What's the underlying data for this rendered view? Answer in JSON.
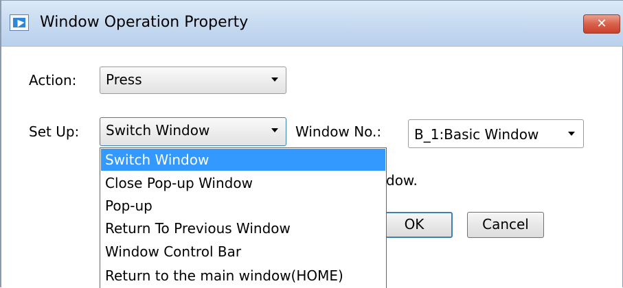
{
  "window": {
    "title": "Window Operation Property",
    "close_label": "✕"
  },
  "action": {
    "label": "Action:",
    "value": "Press"
  },
  "setup": {
    "label": "Set Up:",
    "value": "Switch Window"
  },
  "window_no": {
    "label": "Window No.:",
    "value": "B_1:Basic Window"
  },
  "hidden_text_fragment": "dow.",
  "dropdown": {
    "items": [
      "Switch Window",
      "Close Pop-up Window",
      "Pop-up",
      "Return To Previous Window",
      "Window Control Bar",
      "Return to the main window(HOME)"
    ],
    "selected": "Switch Window"
  },
  "buttons": {
    "ok": "OK",
    "cancel": "Cancel"
  },
  "colors": {
    "selection": "#3399ff",
    "titlebar": "#c9dcf1",
    "close_button": "#d9614c",
    "focus_border": "#3c7fb1"
  }
}
